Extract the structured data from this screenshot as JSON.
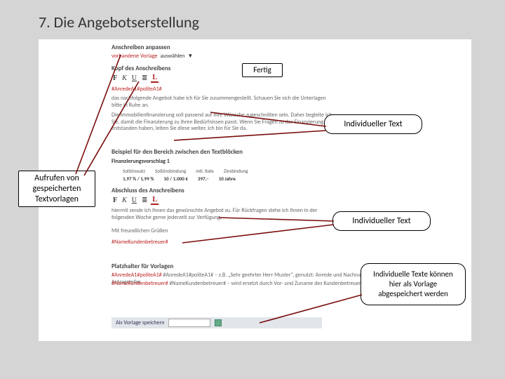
{
  "slide": {
    "title": "7. Die Angebotserstellung"
  },
  "app": {
    "section_anschreiben_anpassen": "Anschreiben anpassen",
    "vorhandene_vorlage": "vorhandene Vorlage",
    "vorlage_option": "auswählen",
    "section_kopf": "Kopf des Anschreibens",
    "anrede_placeholder": "#AnredeA1#politeA1#",
    "paragraph_1": "das nachfolgende Angebot habe ich für Sie zusammengestellt. Schauen Sie sich die Unterlagen bitte in Ruhe an.",
    "paragraph_2": "Die Immobilienfinanzierung soll passend auf Ihre Wünsche zugeschnitten sein. Daher begleite ich Sie, damit die Finanzierung zu Ihren Bedürfnissen passt. Wenn Sie Fragen zu der Finanzierung entstanden haben, leiten Sie diese weiter, ich bin für Sie da.",
    "section_beispiel": "Beispiel für den Bereich zwischen den Textblöcken",
    "fin_heading": "Finanzierungsvorschlag 1",
    "fin_cols": {
      "c1": "Sollzinssatz",
      "c2": "Sollzinsbindung",
      "c3": "mtl. Rate",
      "c4": "Zinsbindung"
    },
    "fin_vals": {
      "v1": "1,97 % / 1,99 %",
      "v2": "10 / 1.000 €",
      "v3": "397,–",
      "v4": "10 Jahre"
    },
    "section_abschluss": "Abschluss des Anschreibens",
    "abschluss_p1": "hiermit sende ich Ihnen das gewünschte Angebot zu. Für Rückfragen stehe ich Ihnen in der folgenden Woche gerne jederzeit zur Verfügung.",
    "gruss": "Mit freundlichen Grüßen",
    "name_placeholder": "#NameKundenbetreuer#",
    "section_platzhalter": "Platzhalter für Vorlagen",
    "platzhalter_text1": "#AnredeA1#politeA1# – z.B. „Sehr geehrter Herr Muster“, genutzt: Anrede und Nachname eines oder beider Antragsteller.",
    "platzhalter_text2": "#NameKundenbetreuer# – wird ersetzt durch Vor- und Zuname des Kundenbetreuers.",
    "save_label": "Als Vorlage speichern",
    "toolbar": {
      "f": "F",
      "k": "K",
      "u": "U",
      "bullets": "≣",
      "l": "L"
    }
  },
  "callouts": {
    "fertig": "Fertig",
    "individueller_text": "Individueller Text",
    "aufrufen": "Aufrufen von\ngespeicherten\nTextvorlagen",
    "speichern": "Individuelle Texte können hier als Vorlage abgespeichert werden"
  }
}
